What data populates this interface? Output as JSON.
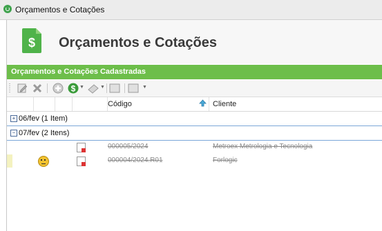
{
  "window": {
    "title": "Orçamentos e Cotações"
  },
  "header": {
    "title": "Orçamentos e Cotações",
    "icon": "dollar-document-icon",
    "icon_color": "#4fb34a"
  },
  "section": {
    "title": "Orçamentos e Cotações Cadastradas",
    "color": "#6dbe4a"
  },
  "toolbar": {
    "icons": [
      "edit-icon",
      "delete-icon",
      "add-icon",
      "money-dropdown-icon",
      "stamp-dropdown-icon",
      "panel-icon",
      "grid-dropdown-icon"
    ]
  },
  "grid": {
    "columns": [
      "",
      "",
      "",
      "Código",
      "Cliente"
    ],
    "groups": [
      {
        "label": "06/fev (1 Item)",
        "expanded": false,
        "rows": []
      },
      {
        "label": "07/fev (2 Itens)",
        "expanded": true,
        "rows": [
          {
            "codigo": "000005/2024",
            "cliente": "Metroex Metrologia e Tecnologia",
            "has_emoji": false
          },
          {
            "codigo": "000004/2024.R01",
            "cliente": "Forlogic",
            "has_emoji": true
          }
        ]
      }
    ]
  }
}
